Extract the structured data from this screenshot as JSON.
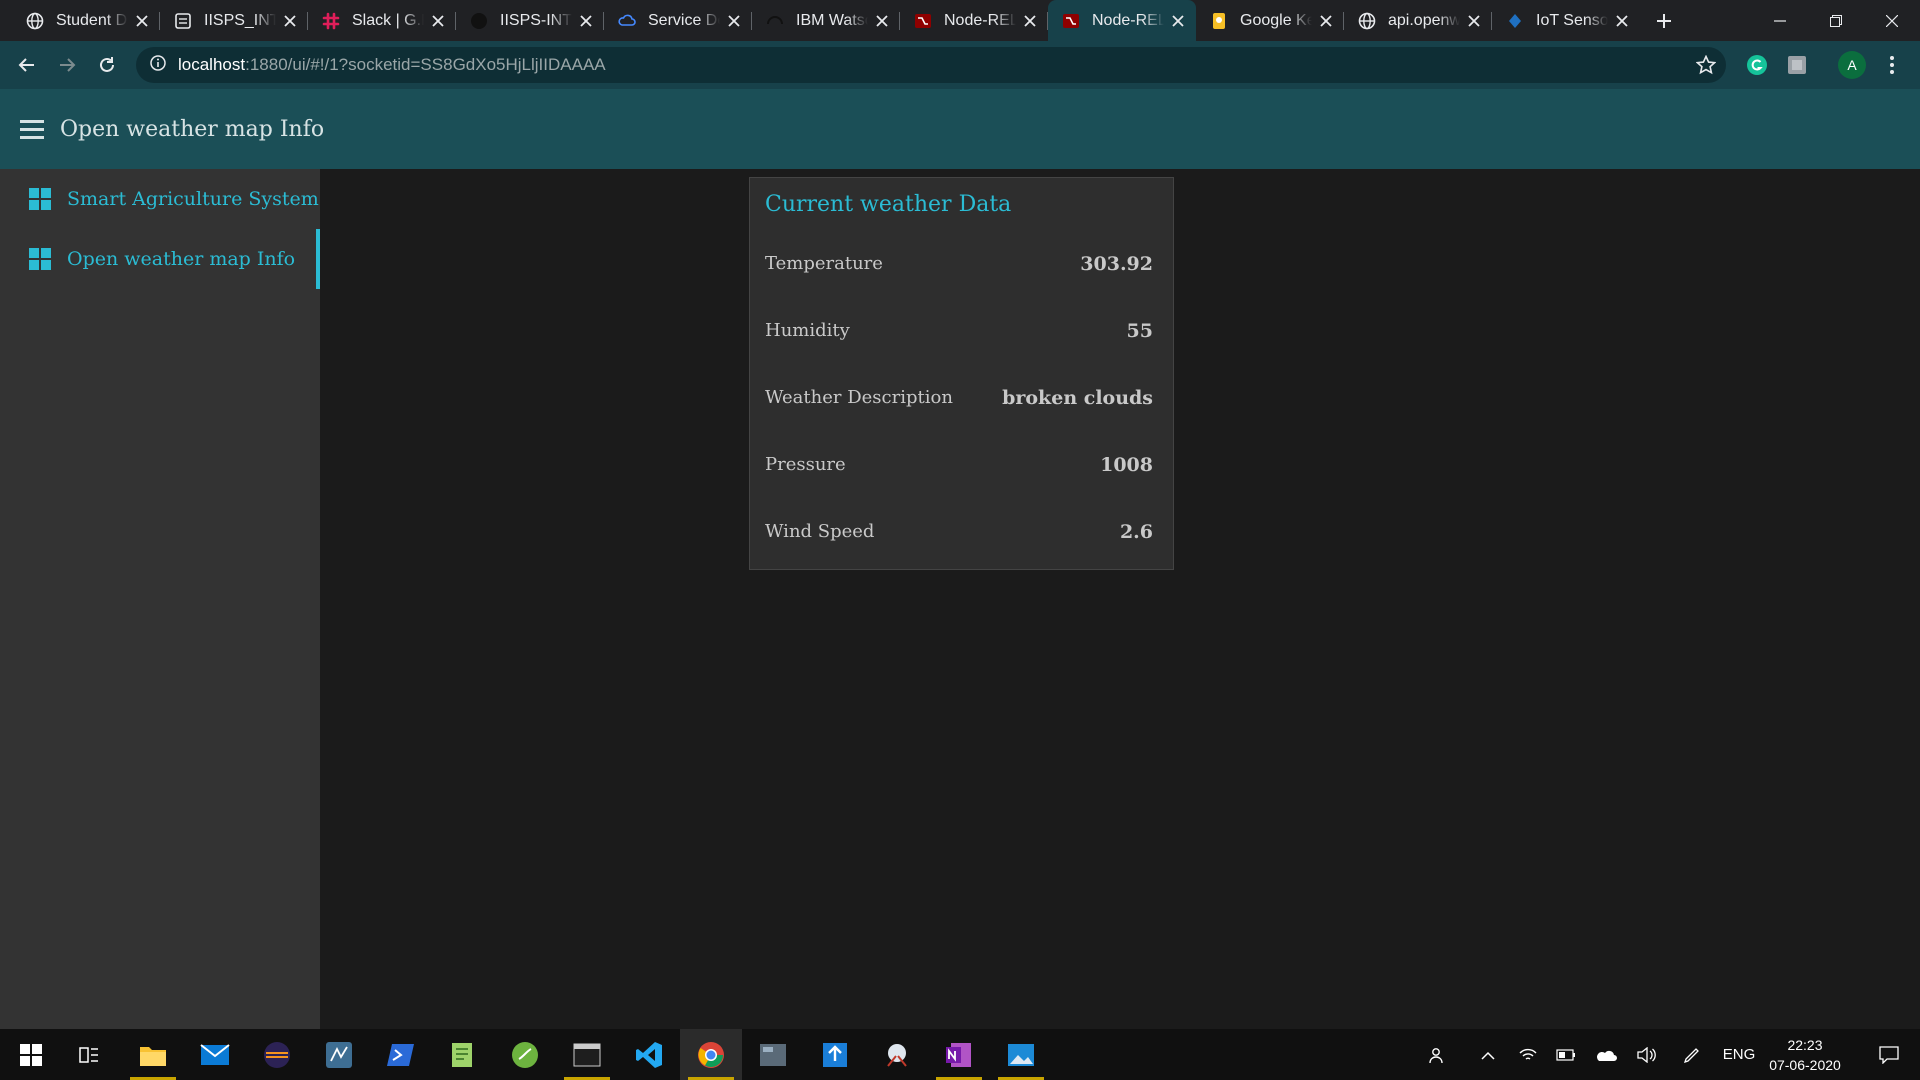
{
  "browser": {
    "tabs": [
      {
        "title": "Student D",
        "icon": "globe-icon"
      },
      {
        "title": "IISPS_INT_",
        "icon": "doc-icon"
      },
      {
        "title": "Slack | G.P",
        "icon": "slack-icon"
      },
      {
        "title": "IISPS-INT-",
        "icon": "github-icon"
      },
      {
        "title": "Service De",
        "icon": "cloud-icon"
      },
      {
        "title": "IBM Watsc",
        "icon": "watson-icon"
      },
      {
        "title": "Node-REL",
        "icon": "node-red-icon"
      },
      {
        "title": "Node-REL",
        "icon": "node-red-icon",
        "active": true
      },
      {
        "title": "Google Ke",
        "icon": "keep-icon"
      },
      {
        "title": "api.openw",
        "icon": "globe-icon"
      },
      {
        "title": "IoT Sensor",
        "icon": "iot-icon"
      }
    ],
    "url_host": "localhost",
    "url_path": ":1880/ui/#!/1?socketid=SS8GdXo5HjLljIIDAAAA",
    "profile_initial": "A"
  },
  "dashboard": {
    "title": "Open weather map Info",
    "nav": [
      {
        "label": "Smart Agriculture System"
      },
      {
        "label": "Open weather map Info",
        "active": true
      }
    ],
    "card": {
      "title": "Current weather Data",
      "rows": [
        {
          "label": "Temperature",
          "value": "303.92"
        },
        {
          "label": "Humidity",
          "value": "55"
        },
        {
          "label": "Weather Description",
          "value": "broken clouds"
        },
        {
          "label": "Pressure",
          "value": "1008"
        },
        {
          "label": "Wind Speed",
          "value": "2.6"
        }
      ]
    }
  },
  "taskbar": {
    "lang": "ENG",
    "time": "22:23",
    "date": "07-06-2020"
  },
  "colors": {
    "accent": "#2bbcd4",
    "appbar": "#1b4f57",
    "sidenav": "#333333"
  }
}
